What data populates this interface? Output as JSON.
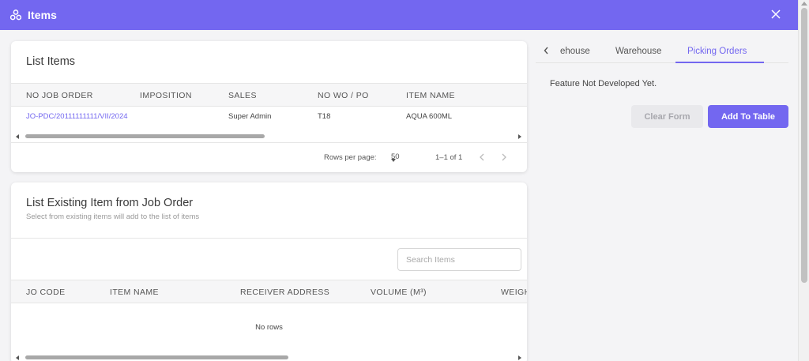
{
  "window": {
    "title": "Items"
  },
  "list_items": {
    "title": "List Items",
    "columns": [
      "NO JOB ORDER",
      "IMPOSITION",
      "SALES",
      "NO WO / PO",
      "ITEM NAME"
    ],
    "rows": [
      {
        "job_order": "JO-PDC/20111111111/VII/2024",
        "imposition": "",
        "sales": "Super Admin",
        "wo_po": "T18",
        "item_name": "AQUA 600ML"
      }
    ],
    "pagination": {
      "rows_per_page_label": "Rows per page:",
      "rows_per_page_value": "50",
      "range": "1–1 of 1"
    }
  },
  "existing_items": {
    "title": "List Existing Item from Job Order",
    "subtitle": "Select from existing items will add to the list of items",
    "search_placeholder": "Search Items",
    "columns": [
      "JO CODE",
      "ITEM NAME",
      "RECEIVER ADDRESS",
      "VOLUME (M³)",
      "WEIGH"
    ],
    "empty_text": "No rows"
  },
  "right_panel": {
    "tabs": [
      "ehouse",
      "Warehouse",
      "Picking Orders"
    ],
    "active_tab": "Picking Orders",
    "message": "Feature Not Developed Yet.",
    "clear_label": "Clear Form",
    "add_label": "Add To Table"
  },
  "colors": {
    "accent": "#7367f0"
  },
  "icons": {
    "app": "hub-icon",
    "close": "close-icon",
    "prev": "chevron-left-icon",
    "next": "chevron-right-icon"
  }
}
